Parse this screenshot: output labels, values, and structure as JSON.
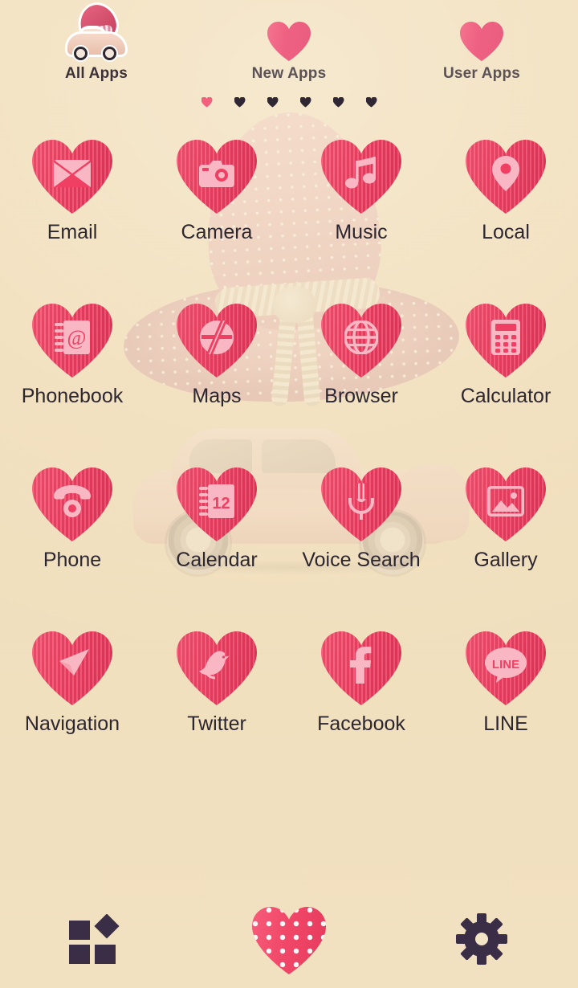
{
  "theme": {
    "background_color": "#f4e4c6",
    "heart_color": "#ef3f62",
    "heart_glyph_color": "#f9b7c3",
    "label_color": "#2c2630",
    "dock_icon_color": "#3a2d46",
    "active_dot_color": "#f2607e",
    "wallpaper_subject": "pink polka-dot sun hat on a vintage pink car"
  },
  "tabs": [
    {
      "label": "All Apps",
      "icon": "car-with-hat-icon",
      "active": true
    },
    {
      "label": "New Apps",
      "icon": "heart-icon",
      "active": false
    },
    {
      "label": "User Apps",
      "icon": "heart-icon",
      "active": false
    }
  ],
  "page_indicator": {
    "total": 6,
    "current": 1,
    "dot_shape": "heart"
  },
  "apps": [
    {
      "label": "Email",
      "icon": "envelope-icon"
    },
    {
      "label": "Camera",
      "icon": "camera-icon"
    },
    {
      "label": "Music",
      "icon": "music-note-icon"
    },
    {
      "label": "Local",
      "icon": "map-pin-icon"
    },
    {
      "label": "Phonebook",
      "icon": "address-book-at-icon"
    },
    {
      "label": "Maps",
      "icon": "globe-road-icon"
    },
    {
      "label": "Browser",
      "icon": "globe-icon"
    },
    {
      "label": "Calculator",
      "icon": "calculator-icon"
    },
    {
      "label": "Phone",
      "icon": "telephone-icon"
    },
    {
      "label": "Calendar",
      "icon": "calendar-icon",
      "badge": "12"
    },
    {
      "label": "Voice Search",
      "icon": "microphone-icon"
    },
    {
      "label": "Gallery",
      "icon": "photo-icon"
    },
    {
      "label": "Navigation",
      "icon": "navigation-arrow-icon"
    },
    {
      "label": "Twitter",
      "icon": "bird-icon"
    },
    {
      "label": "Facebook",
      "icon": "facebook-f-icon"
    },
    {
      "label": "LINE",
      "icon": "line-bubble-icon",
      "glyph_text": "LINE"
    }
  ],
  "dock": [
    {
      "name": "widgets",
      "icon": "widgets-grid-icon"
    },
    {
      "name": "home",
      "icon": "polka-dot-heart-icon"
    },
    {
      "name": "settings",
      "icon": "gear-icon"
    }
  ]
}
